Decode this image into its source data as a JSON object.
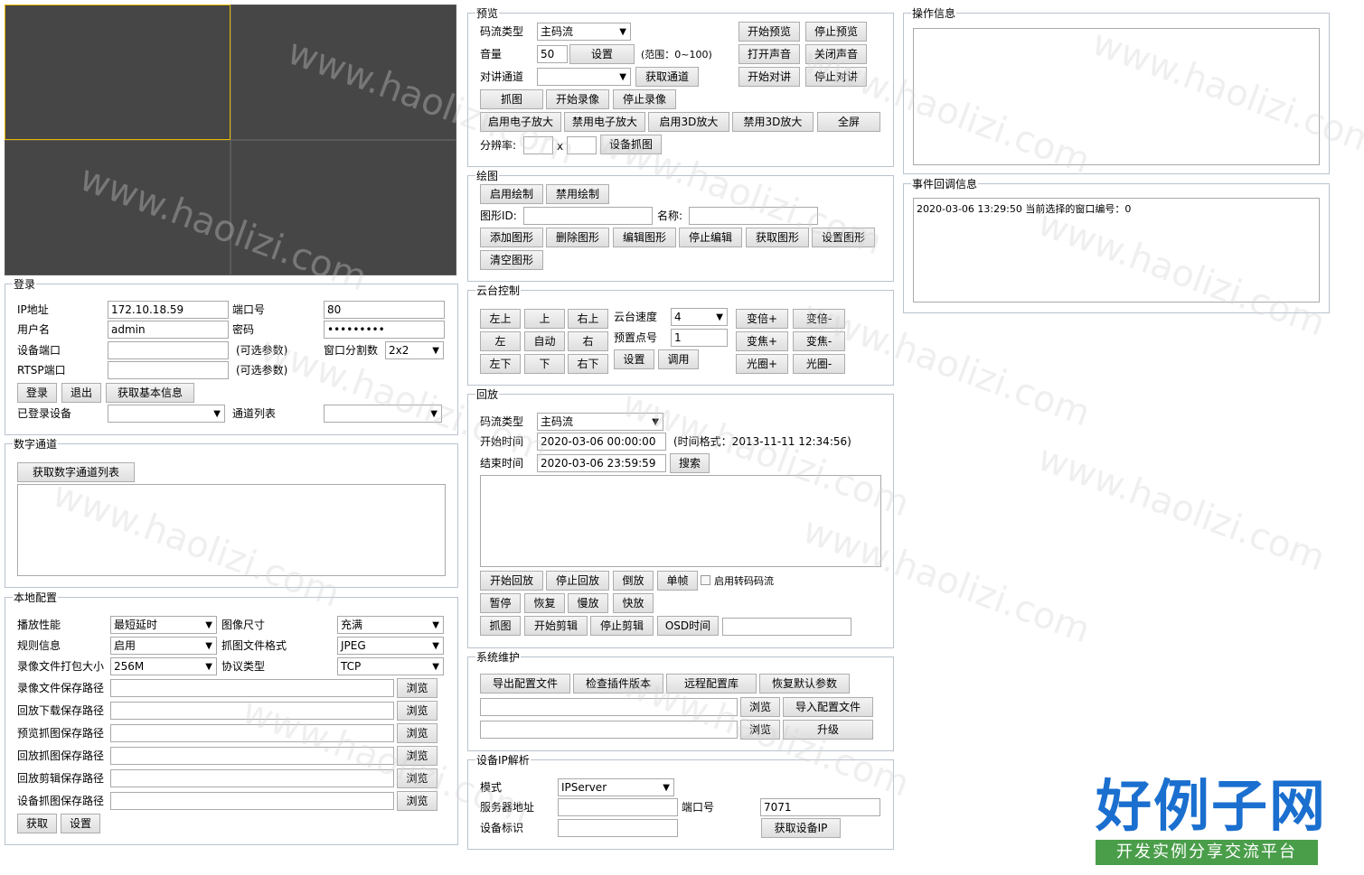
{
  "watermark": "www.haolizi.com",
  "logo": {
    "main": "好例子网",
    "sub": "开发实例分享交流平台"
  },
  "login": {
    "legend": "登录",
    "ip_label": "IP地址",
    "ip_value": "172.10.18.59",
    "port_label": "端口号",
    "port_value": "80",
    "user_label": "用户名",
    "user_value": "admin",
    "pwd_label": "密码",
    "pwd_value": "•••••••••",
    "devport_label": "设备端口",
    "devport_value": "",
    "optional1": "(可选参数)",
    "split_label": "窗口分割数",
    "split_value": "2x2",
    "rtsp_label": "RTSP端口",
    "rtsp_value": "",
    "optional2": "(可选参数)",
    "login_btn": "登录",
    "logout_btn": "退出",
    "getinfo_btn": "获取基本信息",
    "logged_label": "已登录设备",
    "logged_value": "",
    "channel_label": "通道列表",
    "channel_value": ""
  },
  "digital": {
    "legend": "数字通道",
    "get_btn": "获取数字通道列表"
  },
  "local": {
    "legend": "本地配置",
    "play_label": "播放性能",
    "play_value": "最短延时",
    "imgsize_label": "图像尺寸",
    "imgsize_value": "充满",
    "rule_label": "规则信息",
    "rule_value": "启用",
    "capfmt_label": "抓图文件格式",
    "capfmt_value": "JPEG",
    "pack_label": "录像文件打包大小",
    "pack_value": "256M",
    "proto_label": "协议类型",
    "proto_value": "TCP",
    "paths": [
      {
        "label": "录像文件保存路径",
        "btn": "浏览"
      },
      {
        "label": "回放下载保存路径",
        "btn": "浏览"
      },
      {
        "label": "预览抓图保存路径",
        "btn": "浏览"
      },
      {
        "label": "回放抓图保存路径",
        "btn": "浏览"
      },
      {
        "label": "回放剪辑保存路径",
        "btn": "浏览"
      },
      {
        "label": "设备抓图保存路径",
        "btn": "浏览"
      }
    ],
    "get_btn": "获取",
    "set_btn": "设置"
  },
  "preview": {
    "legend": "预览",
    "stream_label": "码流类型",
    "stream_value": "主码流",
    "start_btn": "开始预览",
    "stop_btn": "停止预览",
    "vol_label": "音量",
    "vol_value": "50",
    "vol_set_btn": "设置",
    "vol_range": "(范围：0~100)",
    "open_sound_btn": "打开声音",
    "close_sound_btn": "关闭声音",
    "talk_label": "对讲通道",
    "talk_value": "",
    "get_channel_btn": "获取通道",
    "start_talk_btn": "开始对讲",
    "stop_talk_btn": "停止对讲",
    "capture_btn": "抓图",
    "start_rec_btn": "开始录像",
    "stop_rec_btn": "停止录像",
    "ezoom_on_btn": "启用电子放大",
    "ezoom_off_btn": "禁用电子放大",
    "zoom3d_on_btn": "启用3D放大",
    "zoom3d_off_btn": "禁用3D放大",
    "fullscreen_btn": "全屏",
    "res_label": "分辨率:",
    "res_x": "x",
    "dev_capture_btn": "设备抓图"
  },
  "draw": {
    "legend": "绘图",
    "enable_btn": "启用绘制",
    "disable_btn": "禁用绘制",
    "id_label": "图形ID:",
    "name_label": "名称:",
    "add_btn": "添加图形",
    "del_btn": "删除图形",
    "edit_btn": "编辑图形",
    "stop_edit_btn": "停止编辑",
    "get_btn": "获取图形",
    "set_btn": "设置图形",
    "clear_btn": "清空图形"
  },
  "ptz": {
    "legend": "云台控制",
    "dirs": [
      "左上",
      "上",
      "右上",
      "左",
      "自动",
      "右",
      "左下",
      "下",
      "右下"
    ],
    "speed_label": "云台速度",
    "speed_value": "4",
    "preset_label": "预置点号",
    "preset_value": "1",
    "set_btn": "设置",
    "call_btn": "调用",
    "zoom_in": "变倍+",
    "zoom_out": "变倍-",
    "focus_in": "变焦+",
    "focus_out": "变焦-",
    "iris_in": "光圈+",
    "iris_out": "光圈-"
  },
  "playback": {
    "legend": "回放",
    "stream_label": "码流类型",
    "stream_value": "主码流",
    "start_label": "开始时间",
    "start_value": "2020-03-06 00:00:00",
    "time_fmt": "(时间格式：2013-11-11 12:34:56)",
    "end_label": "结束时间",
    "end_value": "2020-03-06 23:59:59",
    "search_btn": "搜索",
    "start_pb_btn": "开始回放",
    "stop_pb_btn": "停止回放",
    "reverse_btn": "倒放",
    "frame_btn": "单帧",
    "transcode_label": "启用转码码流",
    "pause_btn": "暂停",
    "resume_btn": "恢复",
    "slow_btn": "慢放",
    "fast_btn": "快放",
    "capture_btn": "抓图",
    "start_clip_btn": "开始剪辑",
    "stop_clip_btn": "停止剪辑",
    "osd_btn": "OSD时间"
  },
  "maintain": {
    "legend": "系统维护",
    "export_btn": "导出配置文件",
    "check_btn": "检查插件版本",
    "remote_btn": "远程配置库",
    "restore_btn": "恢复默认参数",
    "browse1_btn": "浏览",
    "import_btn": "导入配置文件",
    "browse2_btn": "浏览",
    "upgrade_btn": "升级"
  },
  "ipparse": {
    "legend": "设备IP解析",
    "mode_label": "模式",
    "mode_value": "IPServer",
    "server_label": "服务器地址",
    "port_label": "端口号",
    "port_value": "7071",
    "id_label": "设备标识",
    "get_btn": "获取设备IP"
  },
  "opinfo": {
    "legend": "操作信息"
  },
  "event": {
    "legend": "事件回调信息",
    "text": "2020-03-06 13:29:50 当前选择的窗口编号：0"
  }
}
